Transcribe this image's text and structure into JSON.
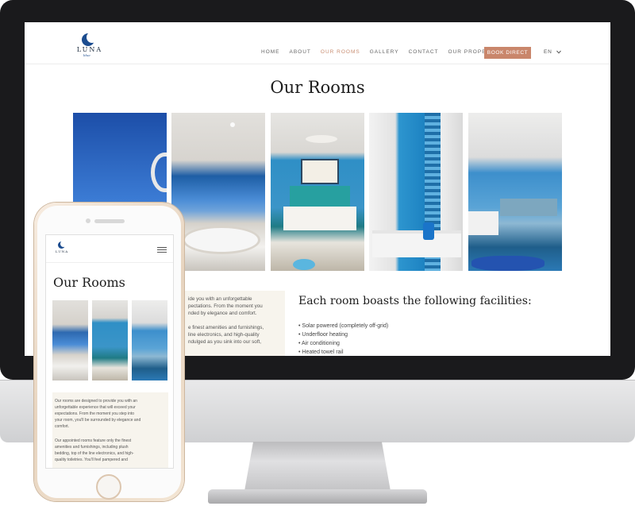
{
  "site": {
    "logo_text": "LUNA",
    "logo_sub": "blue",
    "nav": [
      "HOME",
      "ABOUT",
      "OUR ROOMS",
      "GALLERY",
      "CONTACT",
      "OUR PROPERTIES"
    ],
    "active_nav": "OUR ROOMS",
    "book_button": "BOOK DIRECT",
    "language": "EN",
    "page_title": "Our Rooms",
    "facilities_title": "Each room boasts the following facilities:",
    "facilities": [
      "• Solar powered (completely off-grid)",
      "• Underfloor heating",
      "• Air conditioning",
      "• Heated towel rail"
    ],
    "desktop_card_lines": [
      "ide you with an unforgettable",
      "pectations. From the moment you",
      "nded by elegance and comfort.",
      "",
      "e finest amenities and furnishings,",
      "line electronics, and high-quality",
      "ndulged as you sink into our soft,"
    ]
  },
  "mobile": {
    "page_title": "Our Rooms",
    "card_lines": [
      "Our rooms are designed to provide you with an",
      "unforgettable experience that will exceed your",
      "expectations. From the moment you step into",
      "your room, you'll be surrounded by elegance and",
      "comfort.",
      "",
      "Our appointed rooms feature only the finest",
      "amenities and furnishings, including plush",
      "bedding, top of the line electronics, and high-",
      "quality toiletries. You'll feel pampered and"
    ]
  },
  "colors": {
    "accent": "#c9866b",
    "brand_blue": "#1b4c8f",
    "card_bg": "#f7f4ed"
  },
  "icons": {
    "menu": "hamburger-icon",
    "dropdown": "chevron-down-icon"
  }
}
